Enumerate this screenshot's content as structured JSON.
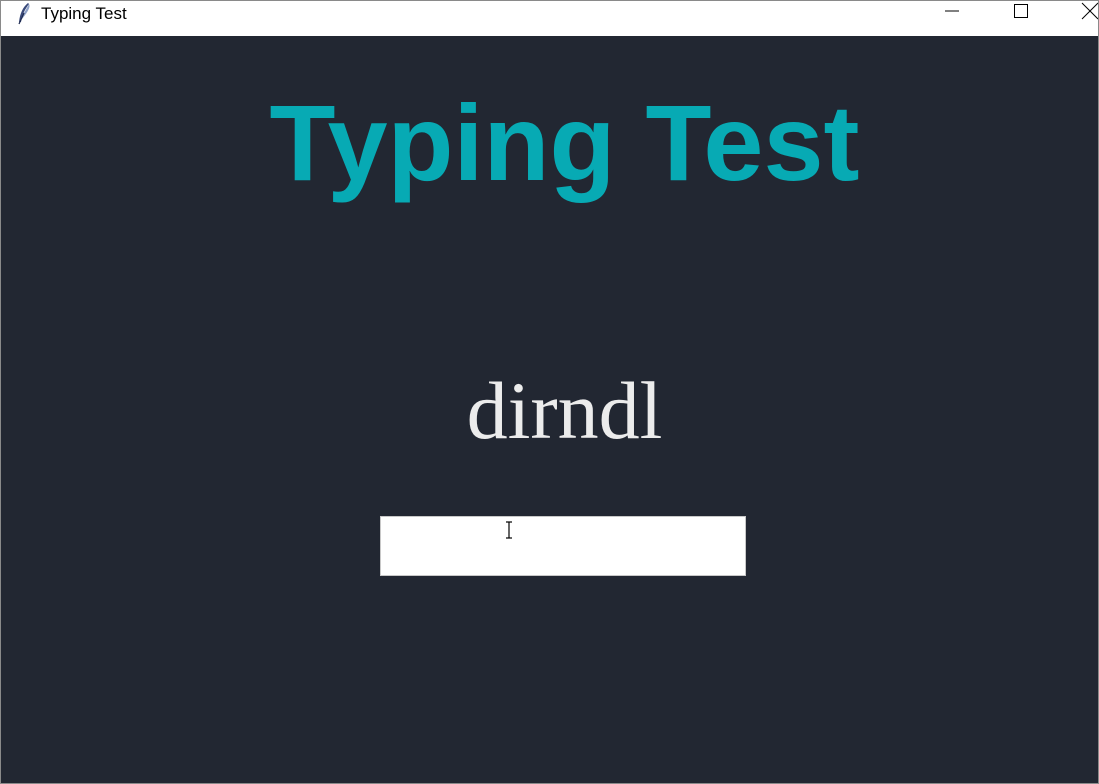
{
  "window": {
    "title": "Typing Test",
    "app_icon": "feather-icon",
    "controls": {
      "minimize_icon": "minimize-icon",
      "maximize_icon": "maximize-icon",
      "close_icon": "close-icon"
    }
  },
  "main": {
    "heading": "Typing Test",
    "current_word": "dirndl",
    "input": {
      "value": "",
      "cursor_icon": "text-cursor-icon"
    }
  },
  "colors": {
    "background": "#222732",
    "heading": "#07aab4",
    "word": "#ececec",
    "input_background": "#ffffff"
  }
}
